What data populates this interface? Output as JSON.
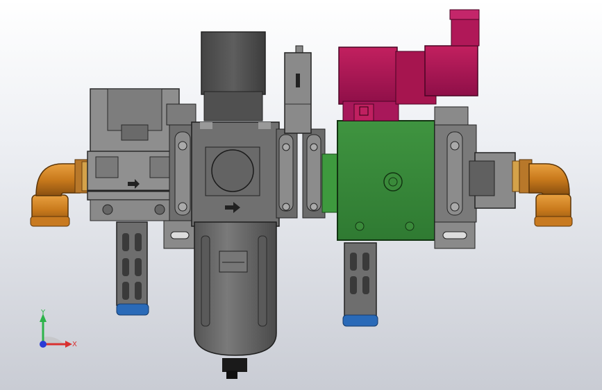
{
  "viewport": {
    "background_top": "#ffffff",
    "background_bottom": "#c9ccd4"
  },
  "triad": {
    "y_label": "Y",
    "x_label": "X",
    "y_color": "#2db34a",
    "x_color": "#d93030",
    "z_color": "#2a3bd6"
  },
  "colors": {
    "metal_light": "#9a9a9a",
    "metal_mid": "#7a7a7a",
    "metal_dark": "#4a4a4a",
    "bowl_gray": "#6c6c6c",
    "valve_green": "#3a8a3a",
    "coil_magenta": "#b0165a",
    "fitting_orange": "#d88a1e",
    "drain_blue": "#2a6ab8"
  },
  "model": {
    "components": [
      {
        "name": "left-elbow-fitting"
      },
      {
        "name": "pressure-regulator"
      },
      {
        "name": "filter-regulator"
      },
      {
        "name": "pressure-switch"
      },
      {
        "name": "solenoid-valve"
      },
      {
        "name": "solenoid-coil"
      },
      {
        "name": "right-elbow-fitting"
      }
    ]
  }
}
